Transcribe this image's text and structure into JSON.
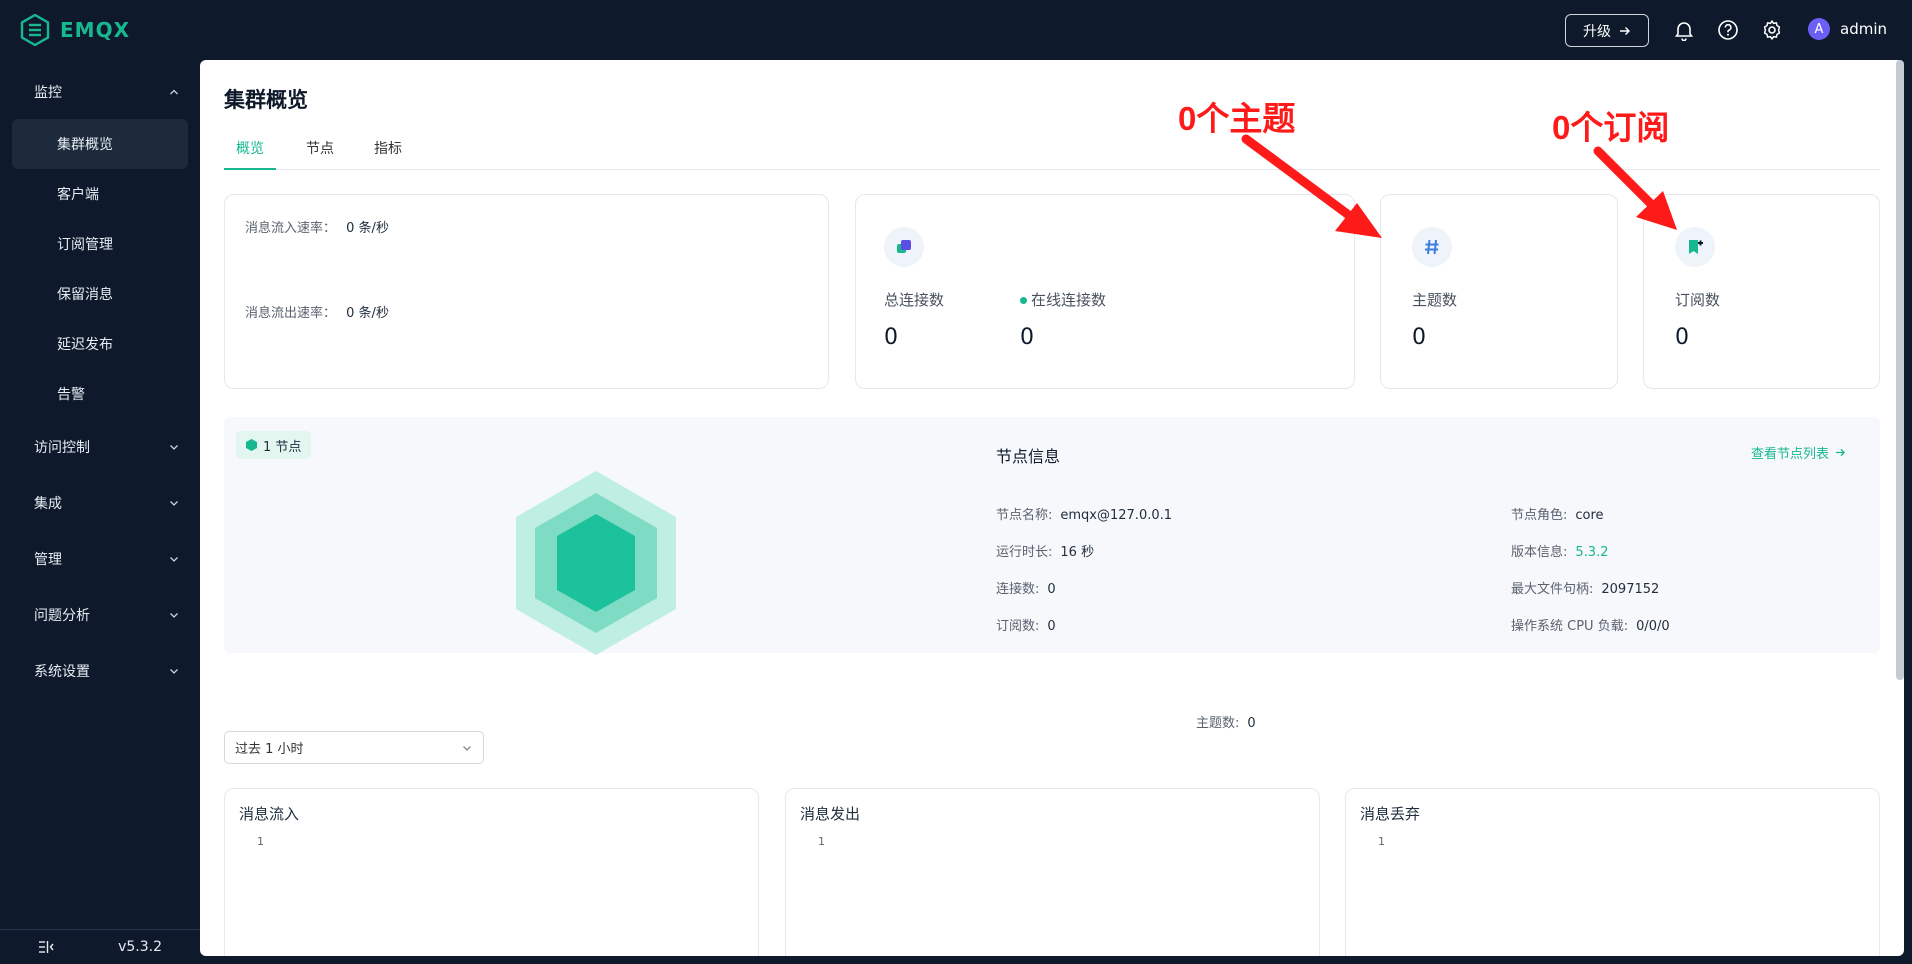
{
  "header": {
    "logo_text": "EMQX",
    "upgrade_label": "升级",
    "user_name": "admin",
    "avatar_letter": "A",
    "icons": [
      "bell-icon",
      "help-icon",
      "gear-icon"
    ]
  },
  "sidebar": {
    "groups": [
      {
        "label": "监控",
        "expanded": true
      },
      {
        "label": "访问控制",
        "expanded": false
      },
      {
        "label": "集成",
        "expanded": false
      },
      {
        "label": "管理",
        "expanded": false
      },
      {
        "label": "问题分析",
        "expanded": false
      },
      {
        "label": "系统设置",
        "expanded": false
      }
    ],
    "items": [
      {
        "label": "集群概览",
        "active": true
      },
      {
        "label": "客户端"
      },
      {
        "label": "订阅管理"
      },
      {
        "label": "保留消息"
      },
      {
        "label": "延迟发布"
      },
      {
        "label": "告警"
      }
    ],
    "version": "v5.3.2"
  },
  "page": {
    "title": "集群概览",
    "tabs": [
      "概览",
      "节点",
      "指标"
    ],
    "active_tab": "概览"
  },
  "rates": {
    "in_label": "消息流入速率：",
    "in_value": "0 条/秒",
    "out_label": "消息流出速率：",
    "out_value": "0 条/秒"
  },
  "stats": {
    "total_conn_label": "总连接数",
    "total_conn_value": "0",
    "online_conn_label": "在线连接数",
    "online_conn_value": "0",
    "topics_label": "主题数",
    "topics_value": "0",
    "subs_label": "订阅数",
    "subs_value": "0"
  },
  "node": {
    "badge": "1 节点",
    "info_title": "节点信息",
    "view_link": "查看节点列表",
    "name_label": "节点名称:",
    "name_value": "emqx@127.0.0.1",
    "uptime_label": "运行时长:",
    "uptime_value": "16 秒",
    "conn_label": "连接数:",
    "conn_value": "0",
    "subs_label": "订阅数:",
    "subs_value": "0",
    "topics_label": "主题数:",
    "topics_value": "0",
    "role_label": "节点角色:",
    "role_value": "core",
    "version_label": "版本信息:",
    "version_value": "5.3.2",
    "max_fd_label": "最大文件句柄:",
    "max_fd_value": "2097152",
    "cpu_label": "操作系统 CPU 负载:",
    "cpu_value": "0/0/0"
  },
  "time_range": {
    "selected": "过去 1 小时"
  },
  "charts": [
    {
      "title": "消息流入",
      "tick": "1"
    },
    {
      "title": "消息发出",
      "tick": "1"
    },
    {
      "title": "消息丢弃",
      "tick": "1"
    }
  ],
  "annotations": {
    "topics_num": "0",
    "topics_text": "个主题",
    "subs_num": "0",
    "subs_text": "个订阅",
    "color": "#ff1a1a"
  },
  "colors": {
    "brand": "#17b890",
    "sidebar_bg": "#0e1a2b",
    "annotation": "#ff1a1a"
  }
}
